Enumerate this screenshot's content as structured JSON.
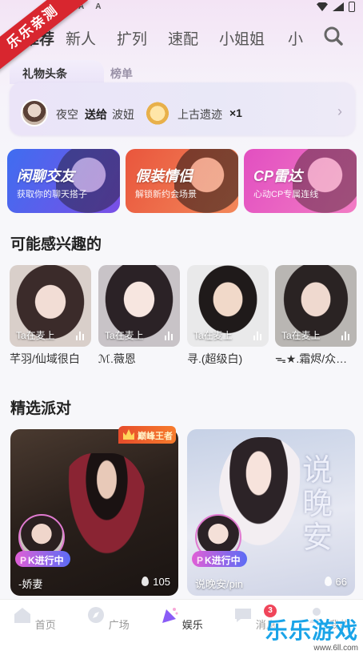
{
  "ribbon": {
    "text": "乐乐亲测"
  },
  "top_tabs": [
    {
      "label": "推荐"
    },
    {
      "label": "新人"
    },
    {
      "label": "扩列"
    },
    {
      "label": "速配"
    },
    {
      "label": "小姐姐"
    },
    {
      "label": "小"
    }
  ],
  "headline": {
    "tab_active": "礼物头条",
    "tab_inactive": "榜单",
    "sender": "夜空",
    "action": "送给",
    "receiver": "波妞",
    "gift_name": "上古遗迹",
    "gift_count": "×1"
  },
  "features": [
    {
      "title": "闲聊交友",
      "subtitle": "获取你的聊天搭子",
      "color_from": "#3f6df0",
      "color_to": "#7b4fe6"
    },
    {
      "title": "假装情侣",
      "subtitle": "解锁新约会场景",
      "color_from": "#e9563d",
      "color_to": "#f3885a"
    },
    {
      "title": "CP雷达",
      "subtitle": "心动CP专属连线",
      "color_from": "#e24fc1",
      "color_to": "#f27cc4"
    }
  ],
  "interest_section": {
    "title": "可能感兴趣的",
    "users": [
      {
        "name": "芊羽/仙域很白",
        "status": "Ta在麦上"
      },
      {
        "name": "ℳ.薇恩",
        "status": "Ta在麦上"
      },
      {
        "name": "寻.(超级白)",
        "status": "Ta在麦上"
      },
      {
        "name": "ᯓ★.霜烬/众…",
        "status": "Ta在麦上"
      }
    ]
  },
  "party_section": {
    "title": "精选派对",
    "badge": "巅峰王者",
    "parties": [
      {
        "name": "-娇妻",
        "status": "K进行中",
        "count": "105"
      },
      {
        "name": "说晚安/pin",
        "status": "K进行中",
        "count": "66"
      }
    ]
  },
  "bottom_nav": [
    {
      "label": "首页"
    },
    {
      "label": "广场"
    },
    {
      "label": "娱乐"
    },
    {
      "label": "消息",
      "badge": "3"
    },
    {
      "label": "我的"
    }
  ],
  "watermark": {
    "brand": "乐乐游戏",
    "url": "www.6ll.com"
  },
  "colors": {
    "accent": "#8a5cf6",
    "active_nav": "#333333",
    "inactive_nav": "#999999"
  }
}
